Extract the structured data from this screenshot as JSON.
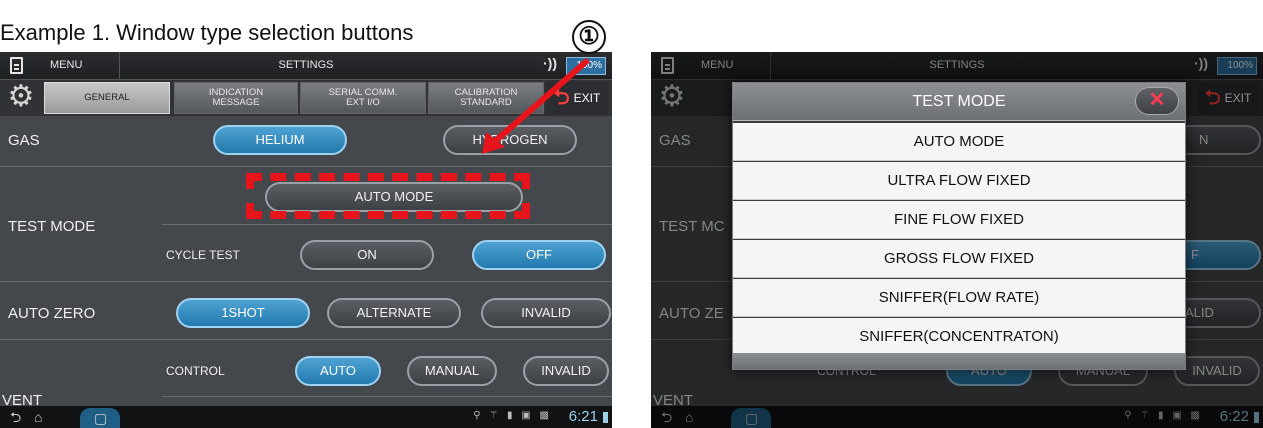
{
  "caption": "Example 1. Window type selection buttons",
  "callout_marker": "①",
  "status_bar": {
    "menu_label": "MENU",
    "title": "SETTINGS",
    "wifi_glyph": "·))",
    "battery": "100%"
  },
  "tabs": {
    "general": "GENERAL",
    "indication_message": "INDICATION\nMESSAGE",
    "serial_comm": "SERIAL COMM.\nEXT I/O",
    "calibration": "CALIBRATION\nSTANDARD",
    "exit": "EXIT"
  },
  "settings": {
    "gas_label": "GAS",
    "gas_helium": "HELIUM",
    "gas_hydrogen": "HYDROGEN",
    "test_mode_label": "TEST MODE",
    "test_mode_value": "AUTO MODE",
    "cycle_test_label": "CYCLE TEST",
    "cycle_on": "ON",
    "cycle_off": "OFF",
    "auto_zero_label": "AUTO ZERO",
    "az_1shot": "1SHOT",
    "az_alternate": "ALTERNATE",
    "az_invalid": "INVALID",
    "control_label": "CONTROL",
    "ctrl_auto": "AUTO",
    "ctrl_manual": "MANUAL",
    "ctrl_invalid": "INVALID",
    "vent_label": "VENT"
  },
  "nav": {
    "clock_left": "6:21",
    "clock_right": "6:22"
  },
  "right_partial": {
    "gas_label": "GAS",
    "gas_n": "N",
    "test_mode_label": "TEST MC",
    "off_f": "F",
    "auto_zero_label": "AUTO ZE",
    "alid": "ALID",
    "invalid": "INVALID",
    "vent_label": "VENT",
    "control_ghost": "CONTROL",
    "auto_ghost": "AUTO",
    "manual_ghost": "MANUAL"
  },
  "modal": {
    "title": "TEST MODE",
    "options": [
      "AUTO MODE",
      "ULTRA FLOW FIXED",
      "FINE FLOW FIXED",
      "GROSS FLOW FIXED",
      "SNIFFER(FLOW RATE)",
      "SNIFFER(CONCENTRATON)"
    ]
  },
  "colors": {
    "selected_button": "#2f8ac0",
    "highlight_red": "#e8141c",
    "close_x": "#ff3a55"
  }
}
